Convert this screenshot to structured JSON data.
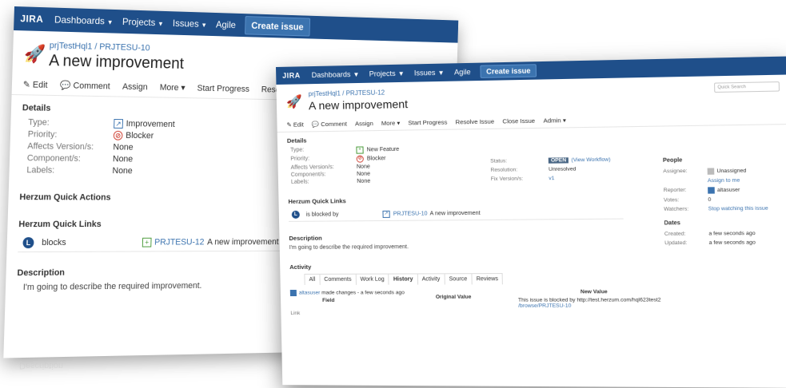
{
  "window1": {
    "nav": {
      "logo": "JIRA",
      "items": [
        "Dashboards",
        "Projects",
        "Issues",
        "Agile"
      ],
      "create": "Create issue"
    },
    "breadcrumb": {
      "project": "prjTestHql1",
      "separator": "/",
      "issue_key": "PRJTESU-10"
    },
    "summary": "A new improvement",
    "toolbar": [
      "Edit",
      "Comment",
      "Assign",
      "More",
      "Start Progress",
      "Resolve"
    ],
    "details_title": "Details",
    "fields": [
      {
        "label": "Type:",
        "value": "Improvement",
        "icon": "improvement-icon"
      },
      {
        "label": "Priority:",
        "value": "Blocker",
        "icon": "blocker-icon"
      },
      {
        "label": "Affects Version/s:",
        "value": "None",
        "icon": ""
      },
      {
        "label": "Component/s:",
        "value": "None",
        "icon": ""
      },
      {
        "label": "Labels:",
        "value": "None",
        "icon": ""
      }
    ],
    "quick_actions_title": "Herzum Quick Actions",
    "quick_links_title": "Herzum Quick Links",
    "quick_link": {
      "relation": "blocks",
      "issue_key": "PRJTESU-12",
      "issue_summary": "A new improvement"
    },
    "description_title": "Description",
    "description_text": "I'm going to describe the required improvement."
  },
  "window2": {
    "nav": {
      "logo": "JIRA",
      "items": [
        "Dashboards",
        "Projects",
        "Issues",
        "Agile"
      ],
      "create": "Create issue"
    },
    "search_placeholder": "Quick Search",
    "breadcrumb": {
      "project": "prjTestHql1",
      "separator": "/",
      "issue_key": "PRJTESU-12"
    },
    "summary": "A new improvement",
    "toolbar": [
      "Edit",
      "Comment",
      "Assign",
      "More",
      "Start Progress",
      "Resolve Issue",
      "Close Issue",
      "Admin"
    ],
    "details_title": "Details",
    "fields": [
      {
        "label": "Type:",
        "value": "New Feature",
        "icon": "new-feature-icon"
      },
      {
        "label": "Priority:",
        "value": "Blocker",
        "icon": "blocker-icon"
      },
      {
        "label": "Affects Version/s:",
        "value": "None",
        "icon": ""
      },
      {
        "label": "Component/s:",
        "value": "None",
        "icon": ""
      },
      {
        "label": "Labels:",
        "value": "None",
        "icon": ""
      }
    ],
    "status": {
      "label": "Status:",
      "badge": "OPEN",
      "view_workflow": "(View Workflow)"
    },
    "resolution": {
      "label": "Resolution:",
      "value": "Unresolved"
    },
    "fix_versions": {
      "label": "Fix Version/s:",
      "value": "v1"
    },
    "people": {
      "title": "People",
      "assignee_label": "Assignee:",
      "assignee": "Unassigned",
      "assign_to_me": "Assign to me",
      "reporter_label": "Reporter:",
      "reporter": "altasuser",
      "votes_label": "Votes:",
      "votes": "0",
      "watchers_label": "Watchers:",
      "watchers": "Stop watching this issue"
    },
    "dates": {
      "title": "Dates",
      "created_label": "Created:",
      "created": "a few seconds ago",
      "updated_label": "Updated:",
      "updated": "a few seconds ago"
    },
    "quick_links_title": "Herzum Quick Links",
    "quick_link": {
      "relation": "is blocked by",
      "issue_key": "PRJTESU-10",
      "issue_summary": "A new improvement"
    },
    "description_title": "Description",
    "description_text": "I'm going to describe the required improvement.",
    "activity_title": "Activity",
    "activity_tabs": [
      "All",
      "Comments",
      "Work Log",
      "History",
      "Activity",
      "Source",
      "Reviews"
    ],
    "history": {
      "user": "altasuser",
      "action": "made changes - a few seconds ago",
      "field_header": "Field",
      "original_header": "Original Value",
      "new_header": "New Value",
      "field": "Link",
      "new_value_line1": "This issue is blocked by http://test.herzum.com/hql623test2",
      "new_value_line2": "/browse/PRJTESU-10"
    }
  },
  "reflection_text": "Description"
}
